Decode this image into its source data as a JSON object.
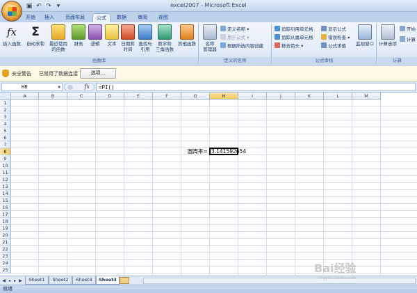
{
  "window": {
    "title": "excel2007 - Microsoft Excel",
    "qat_icons": [
      "save-icon",
      "undo-icon",
      "redo-icon",
      "customize-icon"
    ]
  },
  "tabs": [
    "开始",
    "插入",
    "页面布局",
    "公式",
    "数据",
    "审阅",
    "视图"
  ],
  "active_tab": "公式",
  "ribbon": {
    "function_library": {
      "label": "函数库",
      "insert_function": "插入函数",
      "autosum": "自动求和",
      "recent_line1": "最近使用",
      "recent_line2": "的函数",
      "financial": "财务",
      "logical": "逻辑",
      "text": "文本",
      "datetime_line1": "日期和",
      "datetime_line2": "时间",
      "lookup_line1": "查找与",
      "lookup_line2": "引用",
      "math_line1": "数学和",
      "math_line2": "三角函数",
      "other": "其他函数"
    },
    "defined_names": {
      "label": "定义的名称",
      "manager_line1": "名称",
      "manager_line2": "管理器",
      "define_name": "定义名称",
      "use_in_formula": "用于公式",
      "create_from_selection": "根据所选内容创建"
    },
    "formula_auditing": {
      "label": "公式审核",
      "trace_precedents": "追踪引用单元格",
      "trace_dependents": "追踪从属单元格",
      "remove_arrows": "移去箭头",
      "show_formulas": "显示公式",
      "error_checking": "错误检查",
      "evaluate_formula": "公式求值",
      "watch_window": "监视窗口"
    },
    "calculation": {
      "label": "计算",
      "options_line1": "计算选项",
      "calc_now": "开始",
      "calc_sheet": "计算"
    }
  },
  "security_bar": {
    "title": "安全警告",
    "message": "已禁用了数据连接",
    "options_button": "选项..."
  },
  "formula_bar": {
    "name_box": "H8",
    "fx": "fx",
    "formula": "=PI()"
  },
  "grid": {
    "columns": [
      "A",
      "B",
      "C",
      "D",
      "E",
      "F",
      "G",
      "H",
      "I",
      "J",
      "K",
      "L",
      "M"
    ],
    "rows": [
      "1",
      "2",
      "3",
      "4",
      "5",
      "6",
      "7",
      "8",
      "9",
      "10",
      "11",
      "12",
      "13",
      "14",
      "15",
      "16",
      "17",
      "18",
      "19",
      "20",
      "21",
      "22",
      "23",
      "24",
      "25"
    ],
    "selected_cell": "H8",
    "cells": {
      "G8": "圆周率=",
      "H8": "3.141592654"
    }
  },
  "sheet_tabs": [
    "Sheet1",
    "Sheet2",
    "Sheet4",
    "Sheet3"
  ],
  "active_sheet": "Sheet3",
  "status": "就绪",
  "watermark": {
    "text": "Bai经验",
    "sub": "jingyan.baidu.com"
  }
}
